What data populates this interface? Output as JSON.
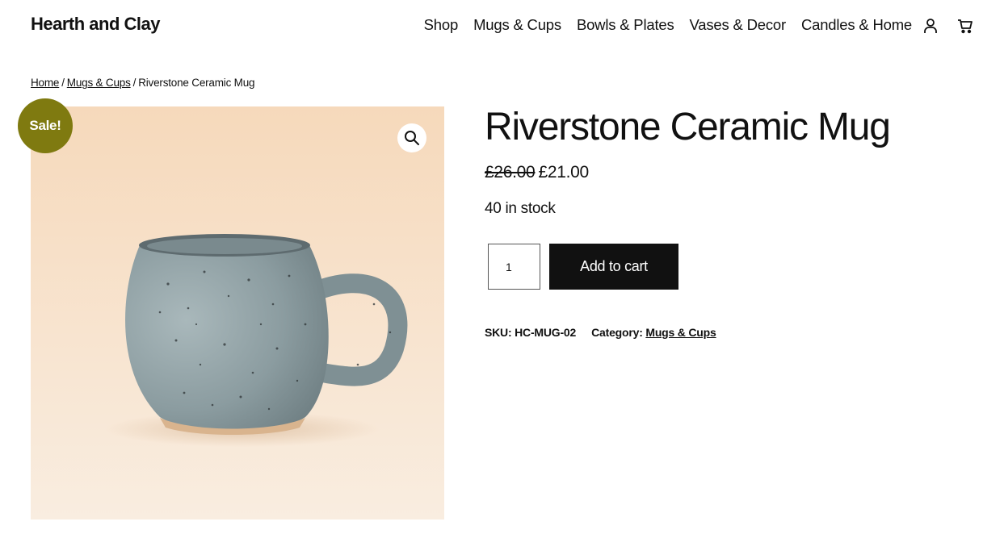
{
  "site": {
    "brand": "Hearth and Clay"
  },
  "nav": {
    "items": [
      {
        "label": "Shop"
      },
      {
        "label": "Mugs & Cups"
      },
      {
        "label": "Bowls & Plates"
      },
      {
        "label": "Vases & Decor"
      },
      {
        "label": "Candles & Home"
      }
    ],
    "icons": [
      "account-icon",
      "cart-icon"
    ]
  },
  "breadcrumb": {
    "home": "Home",
    "category": "Mugs & Cups",
    "current": "Riverstone Ceramic Mug",
    "separator": "/"
  },
  "gallery": {
    "badge": "Sale!",
    "zoom_icon": "search-icon"
  },
  "product": {
    "title": "Riverstone Ceramic Mug",
    "regular_price": "£26.00",
    "sale_price": "£21.00",
    "stock": "40 in stock",
    "quantity": "1",
    "add_to_cart": "Add to cart",
    "sku_label": "SKU:",
    "sku": "HC-MUG-02",
    "category_label": "Category:",
    "category": "Mugs & Cups"
  },
  "colors": {
    "badge": "#7f7a10",
    "button": "#111111",
    "image_bg": "#f4e0c8",
    "mug_glaze": "#8ea0a4"
  }
}
